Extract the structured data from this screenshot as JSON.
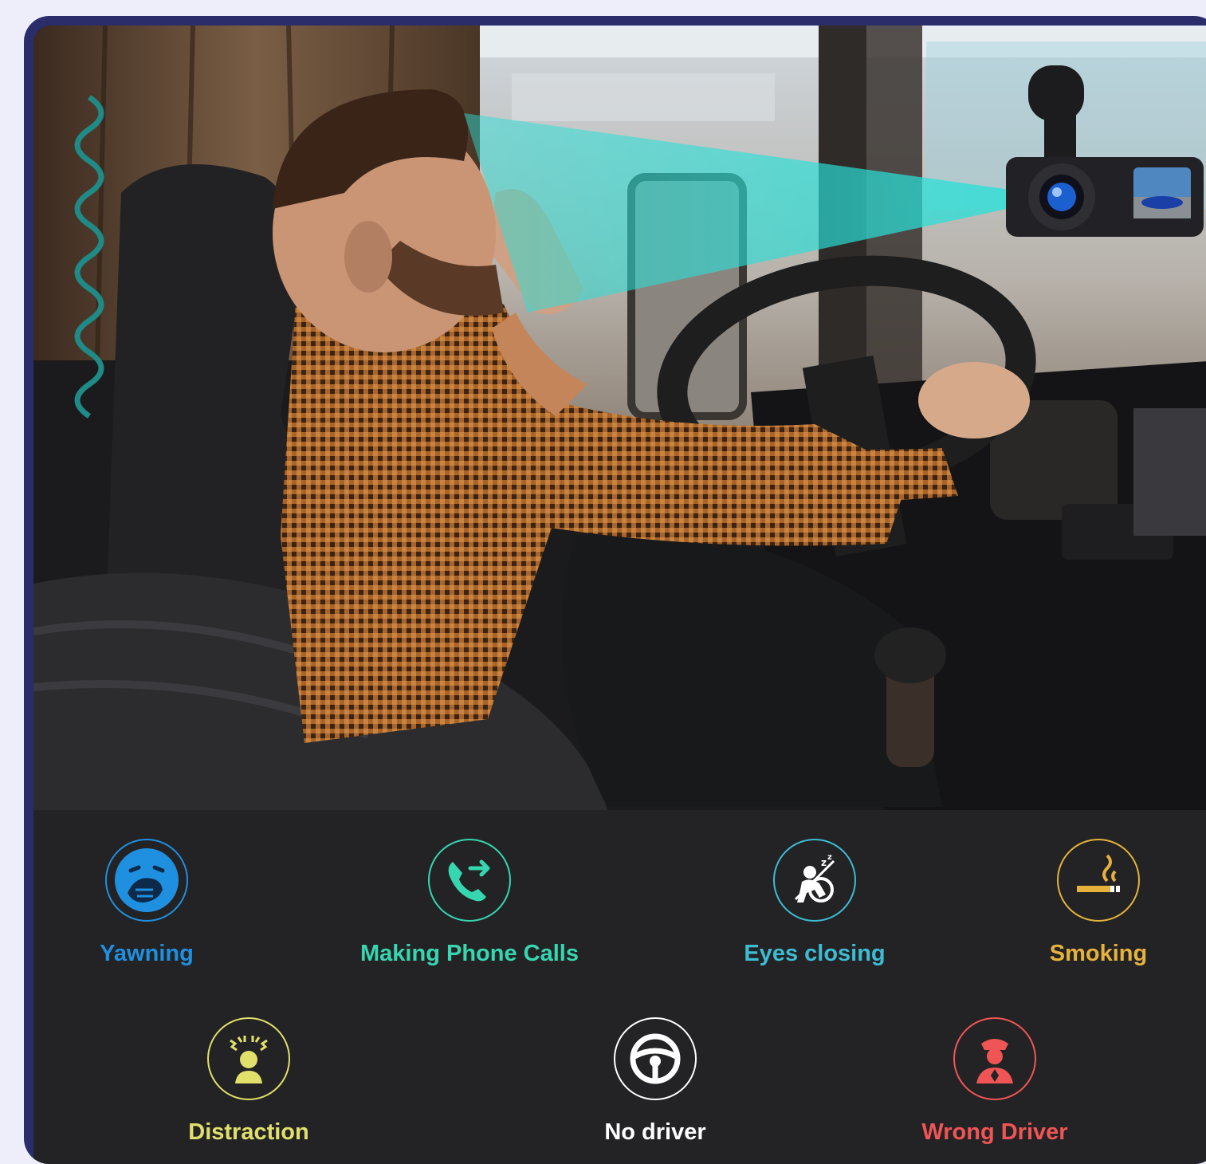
{
  "colors": {
    "page_bg": "#eeeefa",
    "frame": "#2b2d6b",
    "panel": "#232325",
    "blue": "#1f8fe0",
    "green": "#36d6b0",
    "teal": "#3dbcd3",
    "orange": "#e6b23c",
    "yellow": "#e1e06a",
    "white": "#ffffff",
    "red": "#f05555",
    "camera_beam": "#29e0d8"
  },
  "scene": {
    "camera_icon": "dashcam-icon",
    "subject": "driver-yawning-in-truck-cab"
  },
  "features": [
    {
      "label": "Yawning",
      "icon": "yawning-face-icon",
      "color": "#1f8fe0"
    },
    {
      "label": "Making Phone Calls",
      "icon": "phone-call-icon",
      "color": "#36d6b0"
    },
    {
      "label": "Eyes closing",
      "icon": "sleeping-driver-icon",
      "color": "#3dbcd3"
    },
    {
      "label": "Smoking",
      "icon": "cigarette-icon",
      "color": "#e6b23c"
    },
    {
      "label": "Distraction",
      "icon": "distracted-head-icon",
      "color": "#e1e06a"
    },
    {
      "label": "No driver",
      "icon": "steering-wheel-icon",
      "color": "#ffffff"
    },
    {
      "label": "Wrong Driver",
      "icon": "driver-person-icon",
      "color": "#f05555"
    }
  ]
}
